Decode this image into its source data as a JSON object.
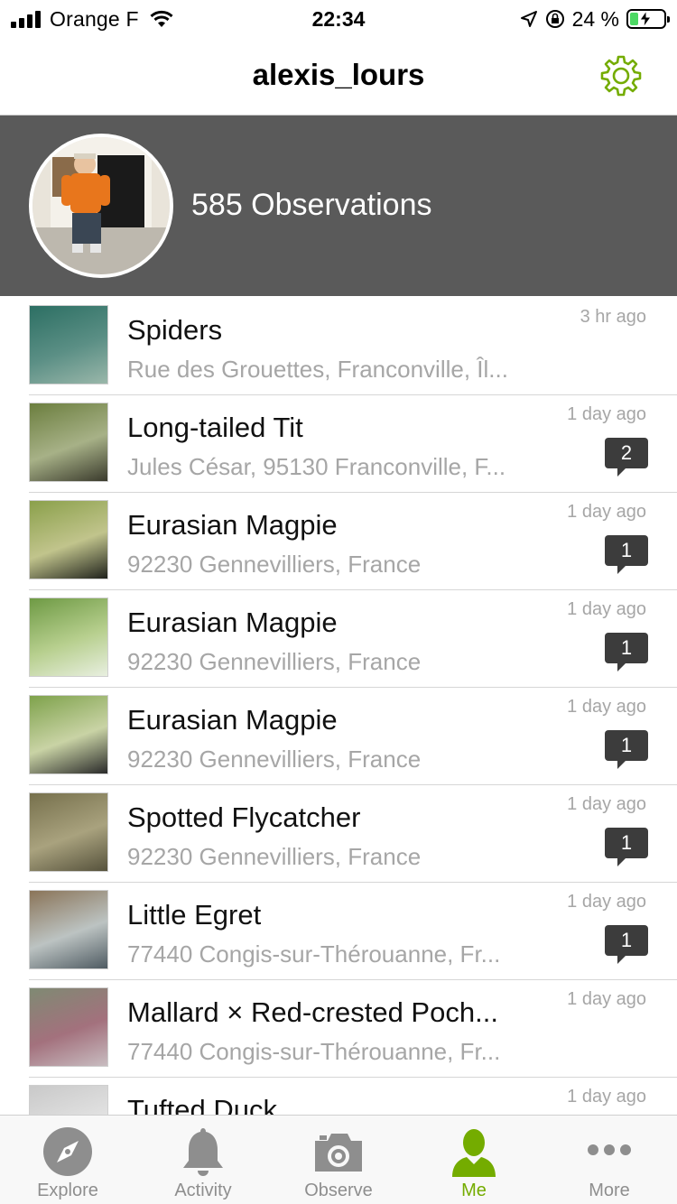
{
  "status_bar": {
    "carrier": "Orange F",
    "time": "22:34",
    "battery_pct": "24 %",
    "battery_level": 0.24
  },
  "nav": {
    "title": "alexis_lours",
    "settings_icon": "gear-icon",
    "accent_color": "#74ac00"
  },
  "profile": {
    "observations_label": "585 Observations"
  },
  "observations": [
    {
      "title": "Spiders",
      "place": "Rue des Grouettes, Franconville, Îl...",
      "time": "3 hr ago",
      "comments": ""
    },
    {
      "title": "Long-tailed Tit",
      "place": "Jules César, 95130 Franconville, F...",
      "time": "1 day ago",
      "comments": "2"
    },
    {
      "title": "Eurasian Magpie",
      "place": "92230 Gennevilliers, France",
      "time": "1 day ago",
      "comments": "1"
    },
    {
      "title": "Eurasian Magpie",
      "place": "92230 Gennevilliers, France",
      "time": "1 day ago",
      "comments": "1"
    },
    {
      "title": "Eurasian Magpie",
      "place": "92230 Gennevilliers, France",
      "time": "1 day ago",
      "comments": "1"
    },
    {
      "title": "Spotted Flycatcher",
      "place": "92230 Gennevilliers, France",
      "time": "1 day ago",
      "comments": "1"
    },
    {
      "title": "Little Egret",
      "place": "77440 Congis-sur-Thérouanne, Fr...",
      "time": "1 day ago",
      "comments": "1"
    },
    {
      "title": "Mallard × Red-crested Poch...",
      "place": "77440 Congis-sur-Thérouanne, Fr...",
      "time": "1 day ago",
      "comments": ""
    },
    {
      "title": "Tufted Duck",
      "place": "",
      "time": "1 day ago",
      "comments": ""
    }
  ],
  "tabs": [
    {
      "label": "Explore",
      "icon": "compass-icon",
      "active": false
    },
    {
      "label": "Activity",
      "icon": "bell-icon",
      "active": false
    },
    {
      "label": "Observe",
      "icon": "camera-icon",
      "active": false
    },
    {
      "label": "Me",
      "icon": "person-icon",
      "active": true
    },
    {
      "label": "More",
      "icon": "more-icon",
      "active": false
    }
  ]
}
